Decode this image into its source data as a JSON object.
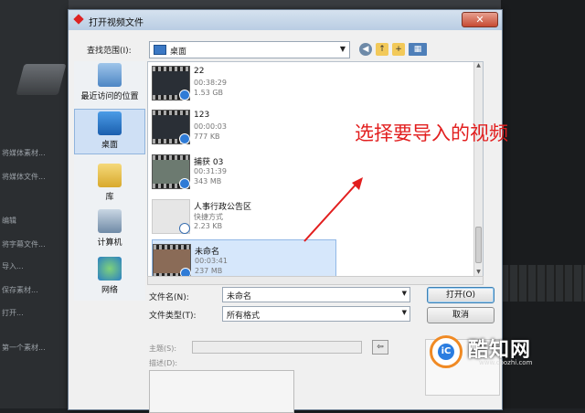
{
  "window": {
    "title": "打开视频文件",
    "close_label": "✕"
  },
  "toolbar": {
    "lookin_label": "查找范围(I):",
    "lookin_value": "桌面"
  },
  "places": [
    {
      "label": "最近访问的位置",
      "icon": "recent-places-icon",
      "selected": false
    },
    {
      "label": "桌面",
      "icon": "desktop-icon",
      "selected": true
    },
    {
      "label": "库",
      "icon": "libraries-icon",
      "selected": false
    },
    {
      "label": "计算机",
      "icon": "computer-icon",
      "selected": false
    },
    {
      "label": "网络",
      "icon": "network-icon",
      "selected": false
    }
  ],
  "files": [
    {
      "name": "22",
      "duration": "00:38:29",
      "size": "1.53 GB",
      "selected": false
    },
    {
      "name": "123",
      "duration": "00:00:03",
      "size": "777 KB",
      "selected": false
    },
    {
      "name": "捕获 03",
      "duration": "00:31:39",
      "size": "343 MB",
      "selected": false
    },
    {
      "name": "人事行政公告区",
      "duration": "快捷方式",
      "size": "2.23 KB",
      "selected": false
    },
    {
      "name": "未命名",
      "duration": "00:03:41",
      "size": "237 MB",
      "selected": true
    }
  ],
  "annotation": {
    "text": "选择要导入的视频",
    "color": "#e21e1e"
  },
  "form": {
    "filename_label": "文件名(N):",
    "filename_value": "未命名",
    "filetype_label": "文件类型(T):",
    "filetype_value": "所有格式",
    "open_label": "打开(O)",
    "cancel_label": "取消",
    "subject_label": "主题(S):",
    "description_label": "描述(D):"
  },
  "background": {
    "left_items": [
      "将媒体素材...",
      "将媒体文件...",
      "编辑",
      "将字幕文件...",
      "导入...",
      "保存素材...",
      "打开...",
      "第一个素材..."
    ]
  },
  "watermark": {
    "name": "酷知网",
    "url": "www.coozhi.com",
    "accent": "#f08a24"
  }
}
